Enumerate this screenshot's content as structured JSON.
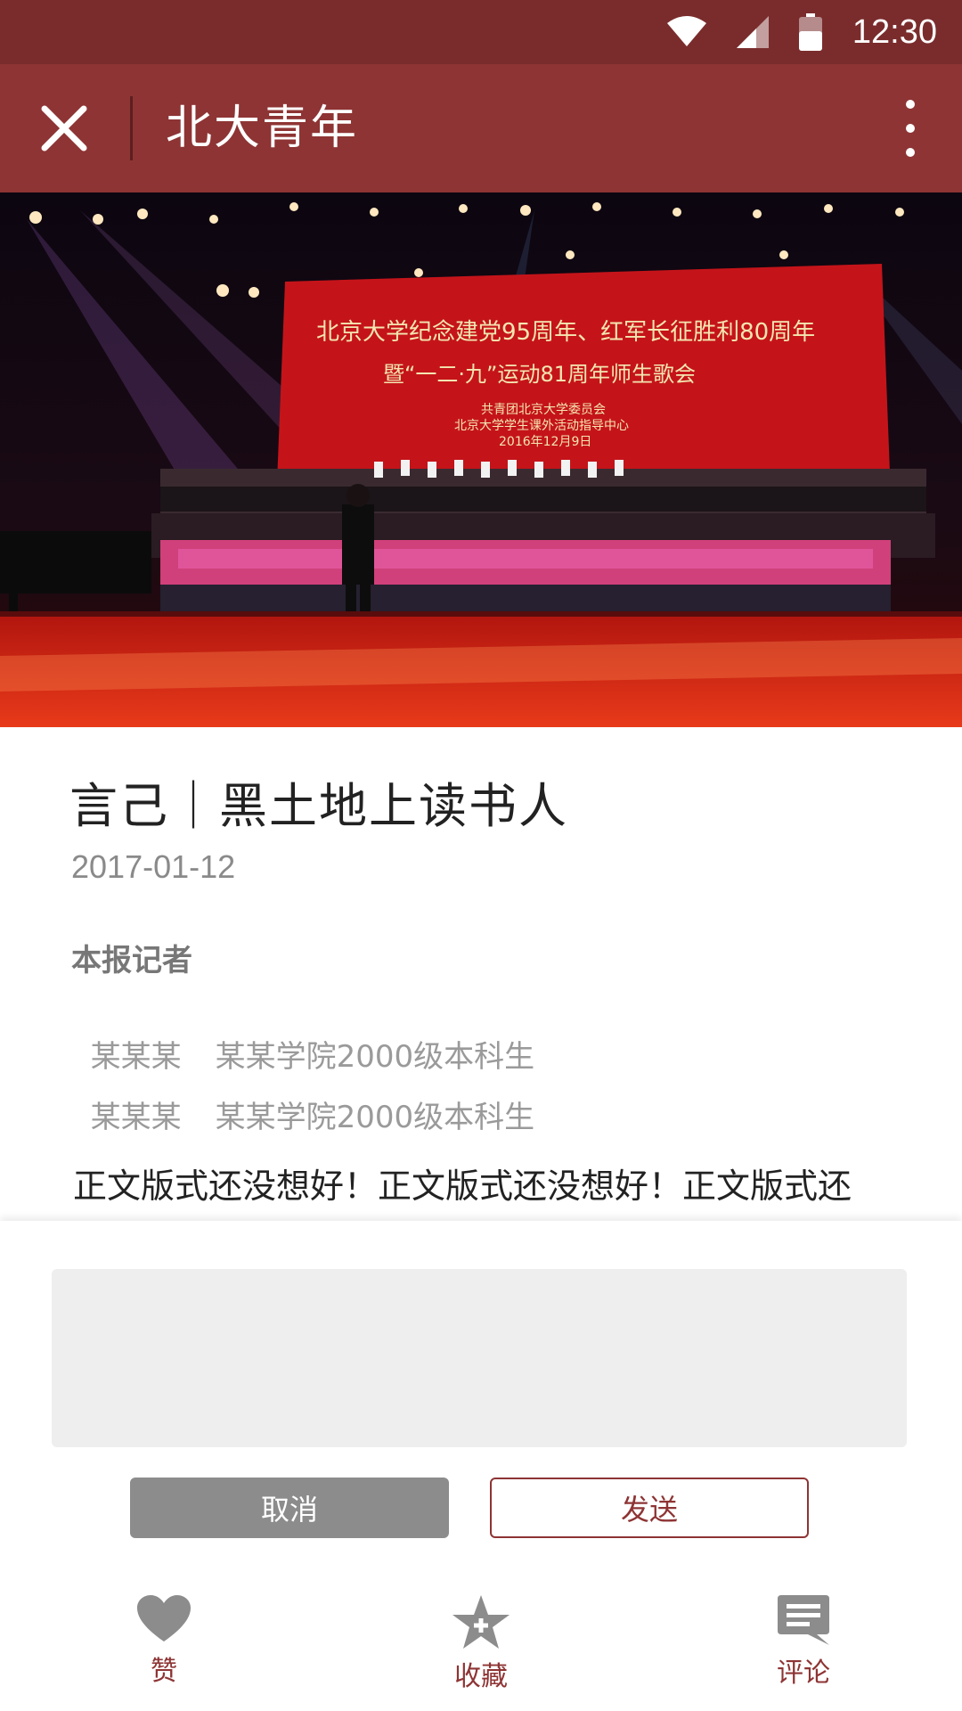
{
  "status_bar": {
    "time": "12:30"
  },
  "app_bar": {
    "title": "北大青年"
  },
  "hero": {
    "banner_line1": "北京大学纪念建党95周年、红军长征胜利80周年",
    "banner_line2": "暨“一二·九”运动81周年师生歌会",
    "banner_line3": "共青团北京大学委员会",
    "banner_line4": "北京大学学生课外活动指导中心",
    "banner_line5": "2016年12月9日"
  },
  "article": {
    "title": "言己｜黑土地上读书人",
    "date": "2017-01-12",
    "reporter_heading": "本报记者",
    "reporters": [
      {
        "name": "某某某",
        "desc": "某某学院2000级本科生"
      },
      {
        "name": "某某某",
        "desc": "某某学院2000级本科生"
      }
    ],
    "body": "正文版式还没想好！正文版式还没想好！正文版式还"
  },
  "comment": {
    "cancel_label": "取消",
    "send_label": "发送"
  },
  "tabs": [
    {
      "label": "赞",
      "icon": "heart-icon"
    },
    {
      "label": "收藏",
      "icon": "star-plus-icon"
    },
    {
      "label": "评论",
      "icon": "comment-icon"
    }
  ],
  "colors": {
    "brand": "#8e3434",
    "status_bar": "#7a2c2c"
  }
}
